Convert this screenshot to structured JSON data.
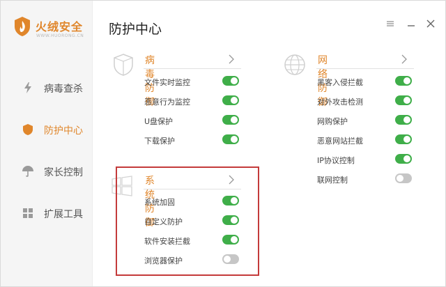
{
  "app": {
    "brand_name": "火绒安全",
    "brand_sub": "WWW.HUORONG.CN",
    "page_title": "防护中心"
  },
  "colors": {
    "accent": "#e0862b",
    "toggle_on": "#3fae49",
    "toggle_off": "#c6c6c6",
    "highlight": "#c43a3a"
  },
  "sidebar": {
    "items": [
      {
        "label": "病毒查杀",
        "icon": "lightning-icon",
        "active": false
      },
      {
        "label": "防护中心",
        "icon": "shield-icon",
        "active": true
      },
      {
        "label": "家长控制",
        "icon": "umbrella-icon",
        "active": false
      },
      {
        "label": "扩展工具",
        "icon": "grid-icon",
        "active": false
      }
    ]
  },
  "window_controls": [
    "menu-icon",
    "minimize-icon",
    "close-icon"
  ],
  "sections": {
    "virus": {
      "title": "病毒防御",
      "icon": "shield-outline-icon",
      "rows": [
        {
          "label": "文件实时监控",
          "on": true
        },
        {
          "label": "恶意行为监控",
          "on": true
        },
        {
          "label": "U盘保护",
          "on": true
        },
        {
          "label": "下载保护",
          "on": true
        }
      ]
    },
    "network": {
      "title": "网络防御",
      "icon": "globe-icon",
      "rows": [
        {
          "label": "黑客入侵拦截",
          "on": true
        },
        {
          "label": "对外攻击检测",
          "on": true
        },
        {
          "label": "网购保护",
          "on": true
        },
        {
          "label": "恶意网站拦截",
          "on": true
        },
        {
          "label": "IP协议控制",
          "on": true
        },
        {
          "label": "联网控制",
          "on": false
        }
      ]
    },
    "system": {
      "title": "系统防御",
      "icon": "windows-icon",
      "rows": [
        {
          "label": "系统加固",
          "on": true
        },
        {
          "label": "自定义防护",
          "on": true
        },
        {
          "label": "软件安装拦截",
          "on": true
        },
        {
          "label": "浏览器保护",
          "on": false
        }
      ]
    }
  }
}
